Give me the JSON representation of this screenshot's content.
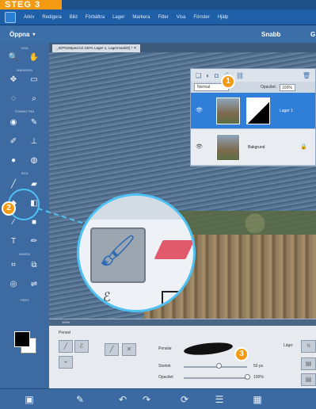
{
  "step_badge": "STEG 3",
  "menubar": {
    "items": [
      "Arkiv",
      "Redigera",
      "Bild",
      "Förbättra",
      "Lager",
      "Markera",
      "Filter",
      "Visa",
      "Fönster",
      "Hjälp"
    ]
  },
  "topbar": {
    "open_label": "Öppna",
    "quick_label": "Snabb",
    "guided_label": "G"
  },
  "toolbox": {
    "sections": {
      "view": "VISA",
      "select": "MARKERA",
      "enhance": "FÖRBÄTTRA",
      "draw": "RITA",
      "modify": "ÄNDRA",
      "color": "FÄRG"
    },
    "text_tool_glyph": "T"
  },
  "document": {
    "tab_label": "_IGP0155ped.nd 100% Lager 1, Lagermask/8) *"
  },
  "layers_panel": {
    "blend_mode": "Normal",
    "opacity_label": "Opacitet:",
    "opacity_value": "100%",
    "layers": [
      {
        "name": "Lager 1",
        "active": true
      },
      {
        "name": "Bakgrund",
        "active": false
      }
    ]
  },
  "callouts": {
    "one": "1",
    "two": "2",
    "three": "3"
  },
  "options_bar": {
    "zoom_value": "100%",
    "tool_label": "Pensel",
    "preset_label": "Penslar",
    "size_label": "Storlek",
    "size_value": "50 px",
    "size_level": 0.55,
    "opacity_label": "Opacitet",
    "opacity_value": "100%",
    "opacity_level": 1.0,
    "mode_label": "Läge:",
    "mode_value": "N"
  },
  "colors": {
    "accent": "#f39a12",
    "highlight": "#4fc2f5",
    "active_layer": "#2f7ed8",
    "eraser": "#e05a6b"
  }
}
